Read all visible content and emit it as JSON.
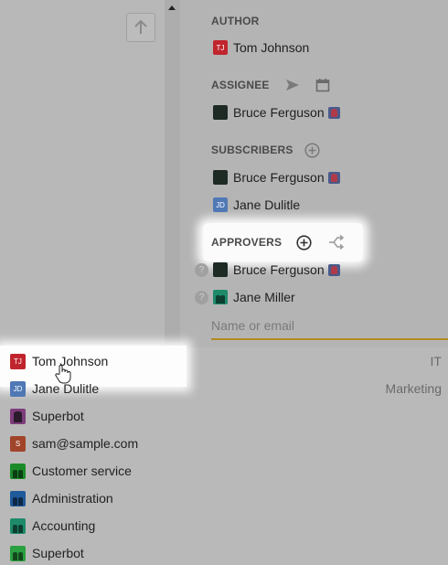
{
  "sections": {
    "author": {
      "heading": "AUTHOR",
      "person": {
        "initials": "TJ",
        "name": "Tom Johnson"
      }
    },
    "assignee": {
      "heading": "ASSIGNEE",
      "person": {
        "name": "Bruce Ferguson"
      }
    },
    "subscribers": {
      "heading": "SUBSCRIBERS",
      "people": [
        {
          "name": "Bruce Ferguson"
        },
        {
          "initials": "JD",
          "name": "Jane Dulitle"
        }
      ]
    },
    "approvers": {
      "heading": "APPROVERS",
      "people": [
        {
          "name": "Bruce Ferguson",
          "status": "?"
        },
        {
          "name": "Jane Miller",
          "status": "?"
        }
      ]
    }
  },
  "input": {
    "placeholder": "Name or email",
    "value": ""
  },
  "dropdown": {
    "items": [
      {
        "initials": "TJ",
        "label": "Tom Johnson",
        "dept": "IT"
      },
      {
        "initials": "JD",
        "label": "Jane Dulitle",
        "dept": "Marketing"
      },
      {
        "label": "Superbot",
        "dept": ""
      },
      {
        "initials": "S",
        "label": "sam@sample.com",
        "dept": ""
      },
      {
        "label": "Customer service",
        "dept": ""
      },
      {
        "label": "Administration",
        "dept": ""
      },
      {
        "label": "Accounting",
        "dept": ""
      },
      {
        "label": "Superbot",
        "dept": ""
      }
    ]
  },
  "colors": {
    "accent_underline": "#b38a22",
    "tj_avatar": "#c0252e",
    "jd_avatar": "#4f78b5"
  }
}
